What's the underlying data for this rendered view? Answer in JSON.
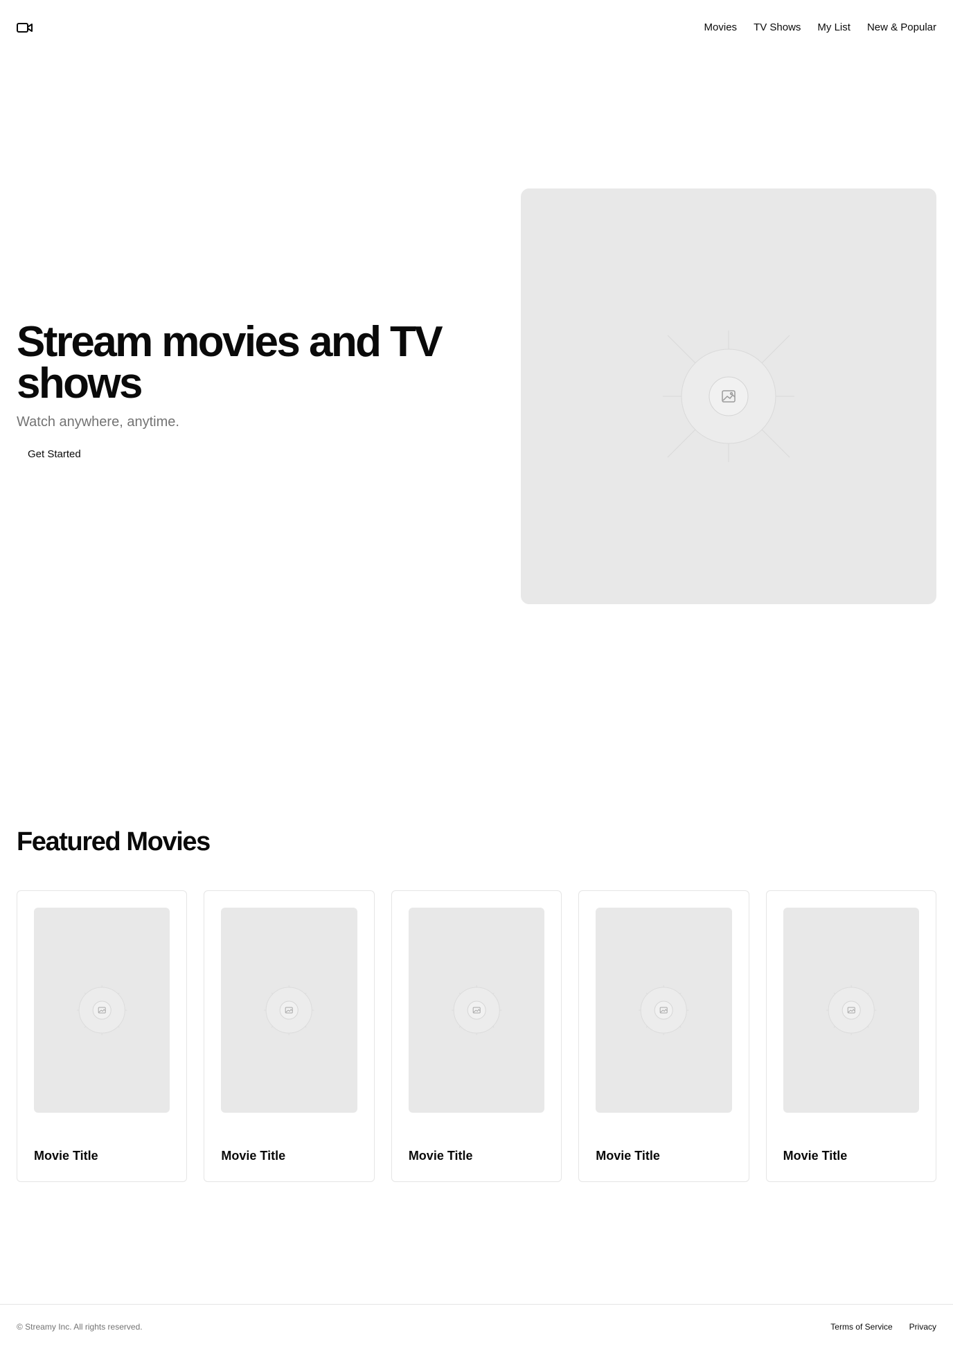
{
  "header": {
    "logo_icon": "video-camera-icon",
    "nav": [
      {
        "label": "Movies"
      },
      {
        "label": "TV Shows"
      },
      {
        "label": "My List"
      },
      {
        "label": "New & Popular"
      }
    ]
  },
  "hero": {
    "title": "Stream movies and TV shows",
    "subtitle": "Watch anywhere, anytime.",
    "cta_label": "Get Started",
    "image_icon": "image-placeholder-icon"
  },
  "featured": {
    "title": "Featured Movies",
    "cards": [
      {
        "title": "Movie Title"
      },
      {
        "title": "Movie Title"
      },
      {
        "title": "Movie Title"
      },
      {
        "title": "Movie Title"
      },
      {
        "title": "Movie Title"
      }
    ]
  },
  "footer": {
    "copyright": "© Streamy Inc. All rights reserved.",
    "links": [
      {
        "label": "Terms of Service"
      },
      {
        "label": "Privacy"
      }
    ]
  },
  "colors": {
    "text": "#0a0a0a",
    "muted": "#737373",
    "placeholder_bg": "#e8e8e8",
    "border": "#e5e5e5"
  }
}
